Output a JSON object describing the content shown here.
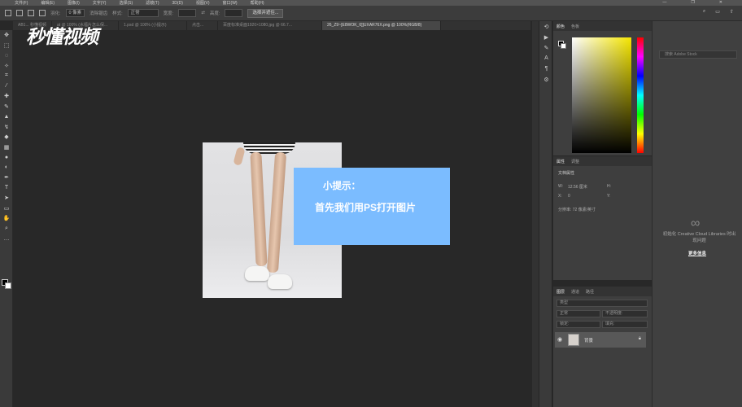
{
  "menu": [
    "文件(F)",
    "编辑(E)",
    "图像(I)",
    "文字(Y)",
    "选择(S)",
    "滤镜(T)",
    "3D(D)",
    "视图(V)",
    "窗口(W)",
    "帮助(H)"
  ],
  "window_controls": [
    "—",
    "❐",
    "✕"
  ],
  "options": {
    "feather_label": "羽化:",
    "feather_value": "0 像素",
    "antialias_label": "消除锯齿",
    "style_label": "样式:",
    "style_value": "正常",
    "width_label": "宽度:",
    "height_label": "高度:",
    "select_mask_button": "选择并遮住..."
  },
  "tabs": [
    {
      "label": "AB1... 秒懂视频",
      "active": false
    },
    {
      "label": "at @ 100% (水福片怎么保...",
      "active": false
    },
    {
      "label": "1.psd @ 100% (小提示)",
      "active": false
    },
    {
      "label": "点击...",
      "active": false
    },
    {
      "label": "百度标准桌面1920×1080.jpg @ 66.7...",
      "active": false
    },
    {
      "label": "26_Z9~[E8WOK_6]]UXAR76X.png @ 100%(RGB/8)",
      "active": true
    }
  ],
  "logo_text": "秒懂视频",
  "tip": {
    "title": "小提示：",
    "body": "首先我们用PS打开图片"
  },
  "color_panel": {
    "tabs": [
      "颜色",
      "色板"
    ]
  },
  "properties": {
    "tabs": [
      "属性",
      "调整"
    ],
    "doc_label": "文档属性",
    "w_label": "W:",
    "w_value": "12.56 厘米",
    "h_label": "H:",
    "x_label": "X:",
    "x_value": "0",
    "y_label": "Y:",
    "resolution": "分辨率: 72 像素/英寸"
  },
  "layers": {
    "tabs": [
      "图层",
      "通道",
      "路径"
    ],
    "kind_label": "类型",
    "mode_value": "正常",
    "opacity_label": "不透明度:",
    "lock_label": "锁定:",
    "fill_label": "填充:",
    "layer_name": "背景"
  },
  "libraries": {
    "search_placeholder": "搜索 Adobe Stock",
    "message": "初始化 Creative Cloud Libraries 时出现问题",
    "link": "更多信息"
  },
  "colors": {
    "tip_bg": "#7bbcff",
    "ui_dark": "#282828",
    "panel": "#3e3e3e"
  }
}
